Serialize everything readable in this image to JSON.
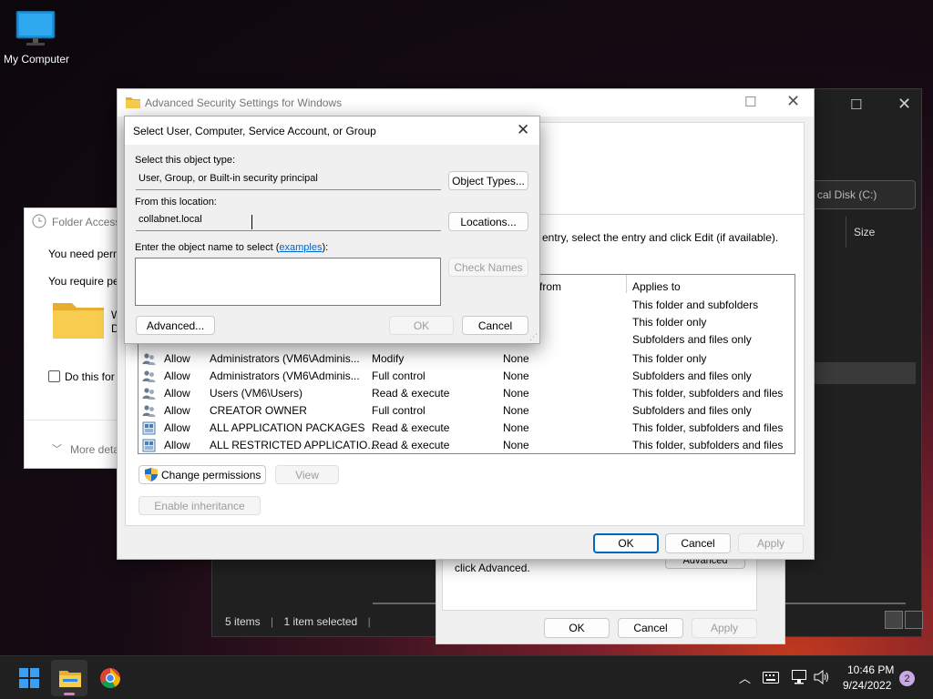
{
  "desktop": {
    "icon_label": "My Computer"
  },
  "explorer": {
    "path": "cal Disk (C:)",
    "column_size": "Size",
    "status_items": "5 items",
    "status_selected": "1 item selected"
  },
  "folder_access": {
    "title": "Folder Access",
    "line1": "You need perm",
    "line2": "You require pe",
    "folder_name_a": "W",
    "folder_name_b": "D",
    "checkbox_label": "Do this for",
    "more_details": "More deta"
  },
  "props": {
    "text": "click Advanced.",
    "advanced_label": "Advanced",
    "ok": "OK",
    "cancel": "Cancel",
    "apply": "Apply"
  },
  "advanced_security": {
    "title": "Advanced Security Settings for Windows",
    "instruction": "entry, select the entry and click Edit (if available).",
    "col_inherited": "d from",
    "col_applies": "Applies to",
    "partial_applies": [
      "This folder and subfolders",
      "This folder only",
      "Subfolders and files only"
    ],
    "rows": [
      {
        "type": "Allow",
        "principal": "Administrators (VM6\\Adminis...",
        "access": "Modify",
        "inherited": "None",
        "applies": "This folder only"
      },
      {
        "type": "Allow",
        "principal": "Administrators (VM6\\Adminis...",
        "access": "Full control",
        "inherited": "None",
        "applies": "Subfolders and files only"
      },
      {
        "type": "Allow",
        "principal": "Users (VM6\\Users)",
        "access": "Read & execute",
        "inherited": "None",
        "applies": "This folder, subfolders and files"
      },
      {
        "type": "Allow",
        "principal": "CREATOR OWNER",
        "access": "Full control",
        "inherited": "None",
        "applies": "Subfolders and files only"
      },
      {
        "type": "Allow",
        "principal": "ALL APPLICATION PACKAGES",
        "access": "Read & execute",
        "inherited": "None",
        "applies": "This folder, subfolders and files"
      },
      {
        "type": "Allow",
        "principal": "ALL RESTRICTED APPLICATIO...",
        "access": "Read & execute",
        "inherited": "None",
        "applies": "This folder, subfolders and files"
      }
    ],
    "change_permissions": "Change permissions",
    "view": "View",
    "enable_inheritance": "Enable inheritance",
    "ok": "OK",
    "cancel": "Cancel",
    "apply": "Apply"
  },
  "select_dialog": {
    "title": "Select User, Computer, Service Account, or Group",
    "object_type_label": "Select this object type:",
    "object_type_value": "User, Group, or Built-in security principal",
    "object_types_button": "Object Types...",
    "location_label": "From this location:",
    "location_value": "collabnet.local",
    "locations_button": "Locations...",
    "enter_name_label": "Enter the object name to select (",
    "examples_link": "examples",
    "enter_name_suffix": "):",
    "object_name_value": "",
    "check_names_button": "Check Names",
    "advanced_button": "Advanced...",
    "ok": "OK",
    "cancel": "Cancel"
  },
  "taskbar": {
    "time": "10:46 PM",
    "date": "9/24/2022",
    "notification_count": "2"
  },
  "colors": {
    "accent": "#0067c0",
    "taskbar": "#202020",
    "folder": "#f4c542"
  }
}
